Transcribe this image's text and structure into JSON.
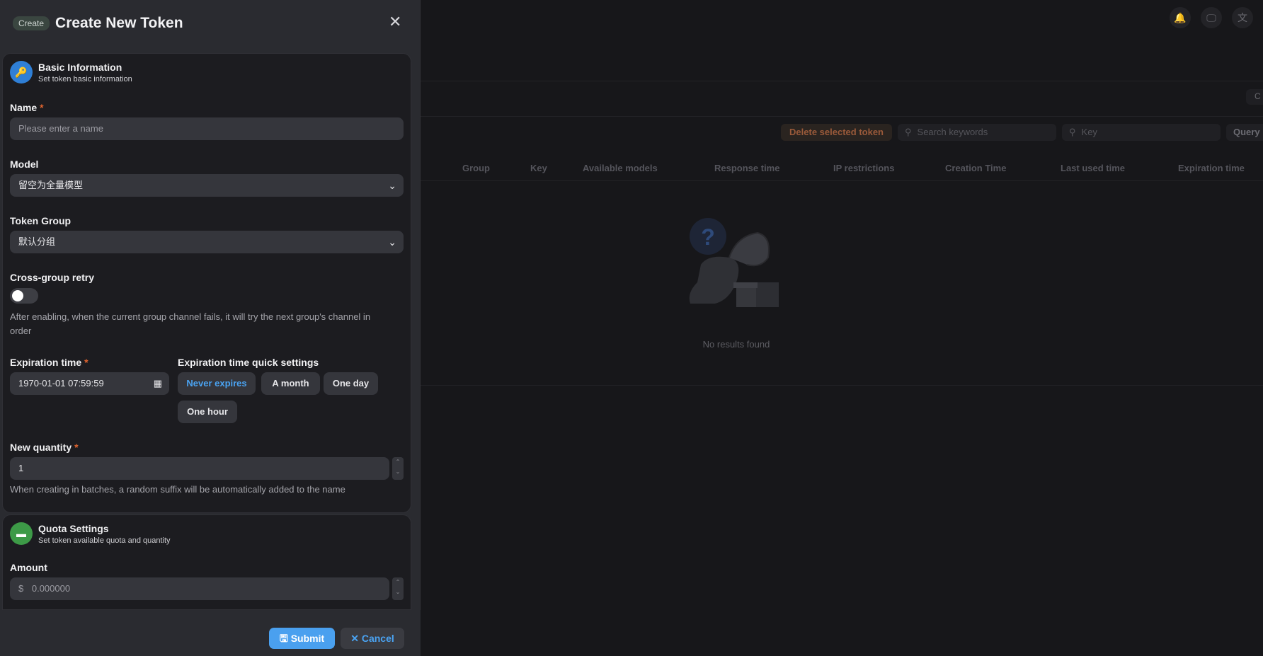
{
  "background": {
    "toolbar": {
      "delete_label": "Delete selected token",
      "search_placeholder": "Search keywords",
      "key_placeholder": "Key",
      "query_label": "Query",
      "side_button_label": "C"
    },
    "table": {
      "columns": [
        "Group",
        "Key",
        "Available models",
        "Response time",
        "IP restrictions",
        "Creation Time",
        "Last used time",
        "Expiration time"
      ],
      "empty_text": "No results found"
    }
  },
  "panel": {
    "tag": "Create",
    "title": "Create New Token",
    "basic": {
      "title": "Basic Information",
      "subtitle": "Set token basic information",
      "name_label": "Name",
      "name_placeholder": "Please enter a name",
      "model_label": "Model",
      "model_value": "留空为全量模型",
      "group_label": "Token Group",
      "group_value": "默认分组",
      "retry_label": "Cross-group retry",
      "retry_enabled": false,
      "retry_help_1": "After enabling, when the current group channel fails, it will try the next group's channel in",
      "retry_help_2": "order",
      "expiration_label": "Expiration time",
      "expiration_value": "1970-01-01 07:59:59",
      "quick_label": "Expiration time quick settings",
      "quick_options": [
        "Never expires",
        "A month",
        "One day",
        "One hour"
      ],
      "quick_selected": "Never expires",
      "quantity_label": "New quantity",
      "quantity_value": "1",
      "quantity_help": "When creating in batches, a random suffix will be automatically added to the name"
    },
    "quota": {
      "title": "Quota Settings",
      "subtitle": "Set token available quota and quantity",
      "amount_label": "Amount",
      "currency": "$",
      "amount_placeholder": "0.000000"
    },
    "submit_label": "Submit",
    "cancel_label": "Cancel"
  },
  "colors": {
    "accent": "#4aa3f2",
    "basic_icon": "#2f7fd6",
    "quota_icon": "#3d9a47",
    "required": "#e0642f"
  }
}
